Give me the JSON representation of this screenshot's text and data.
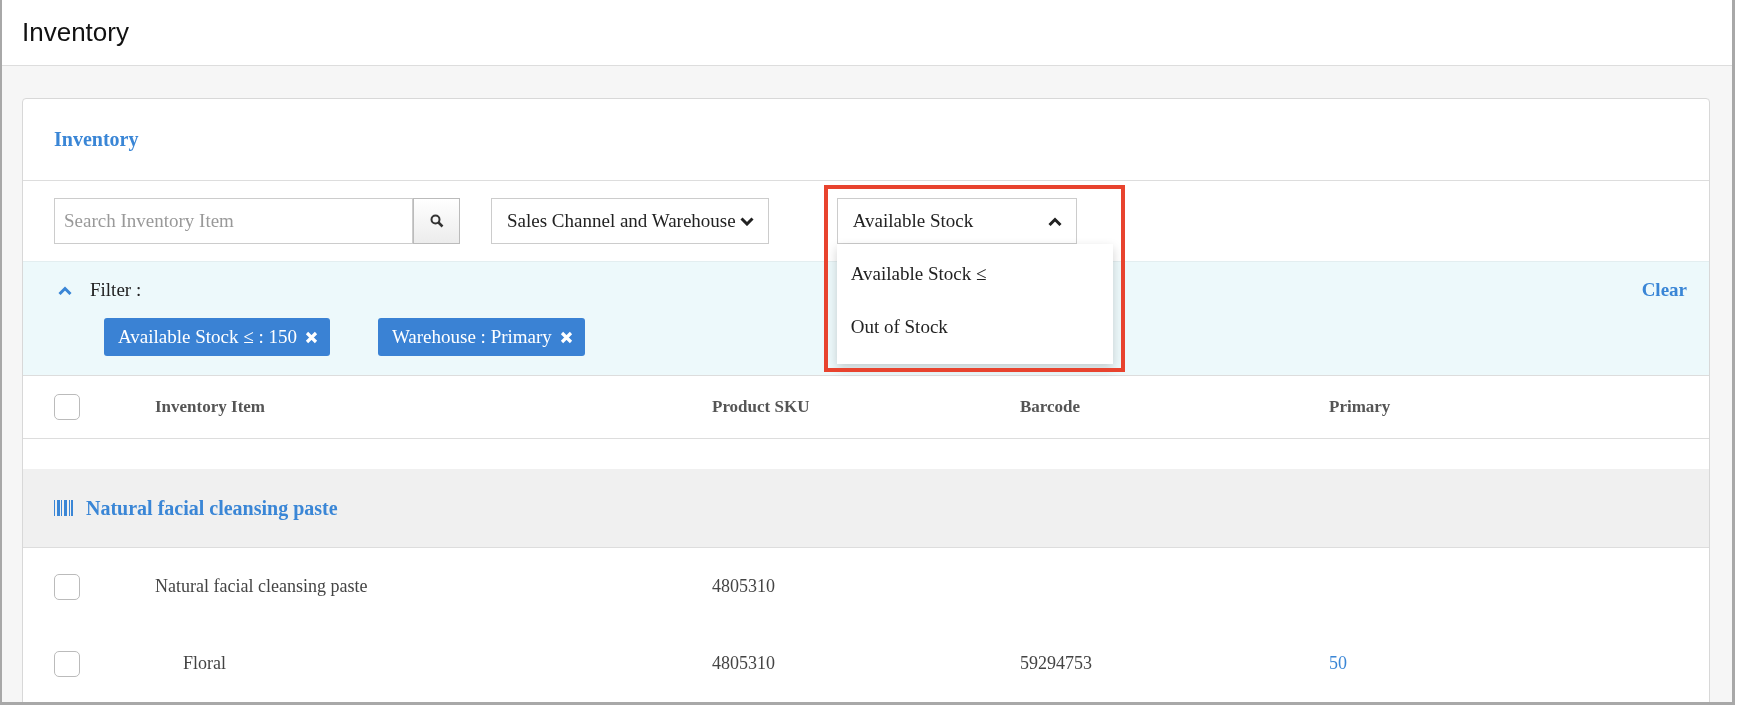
{
  "page": {
    "title": "Inventory"
  },
  "card": {
    "title": "Inventory"
  },
  "search": {
    "placeholder": "Search Inventory Item"
  },
  "dropdowns": [
    {
      "label": "Sales Channel and Warehouse",
      "expanded": false,
      "highlighted": false
    },
    {
      "label": "Available Stock",
      "expanded": true,
      "highlighted": true,
      "options": [
        "Available Stock ≤",
        "Out of Stock"
      ]
    }
  ],
  "filter": {
    "label": "Filter :",
    "expanded": true,
    "clear": "Clear",
    "chips": [
      "Available Stock ≤ : 150",
      "Warehouse : Primary"
    ]
  },
  "table": {
    "header_checked": false,
    "columns": [
      "Inventory Item",
      "Product SKU",
      "Barcode",
      "Primary"
    ],
    "groups": [
      {
        "title": "Natural facial cleansing paste",
        "rows": [
          {
            "checked": false,
            "item": "Natural facial cleansing paste",
            "sku": "4805310",
            "children": [
              {
                "checked": false,
                "item": "Floral",
                "sku": "4805310",
                "barcode": "59294753",
                "primary": "50"
              }
            ]
          }
        ]
      }
    ]
  }
}
